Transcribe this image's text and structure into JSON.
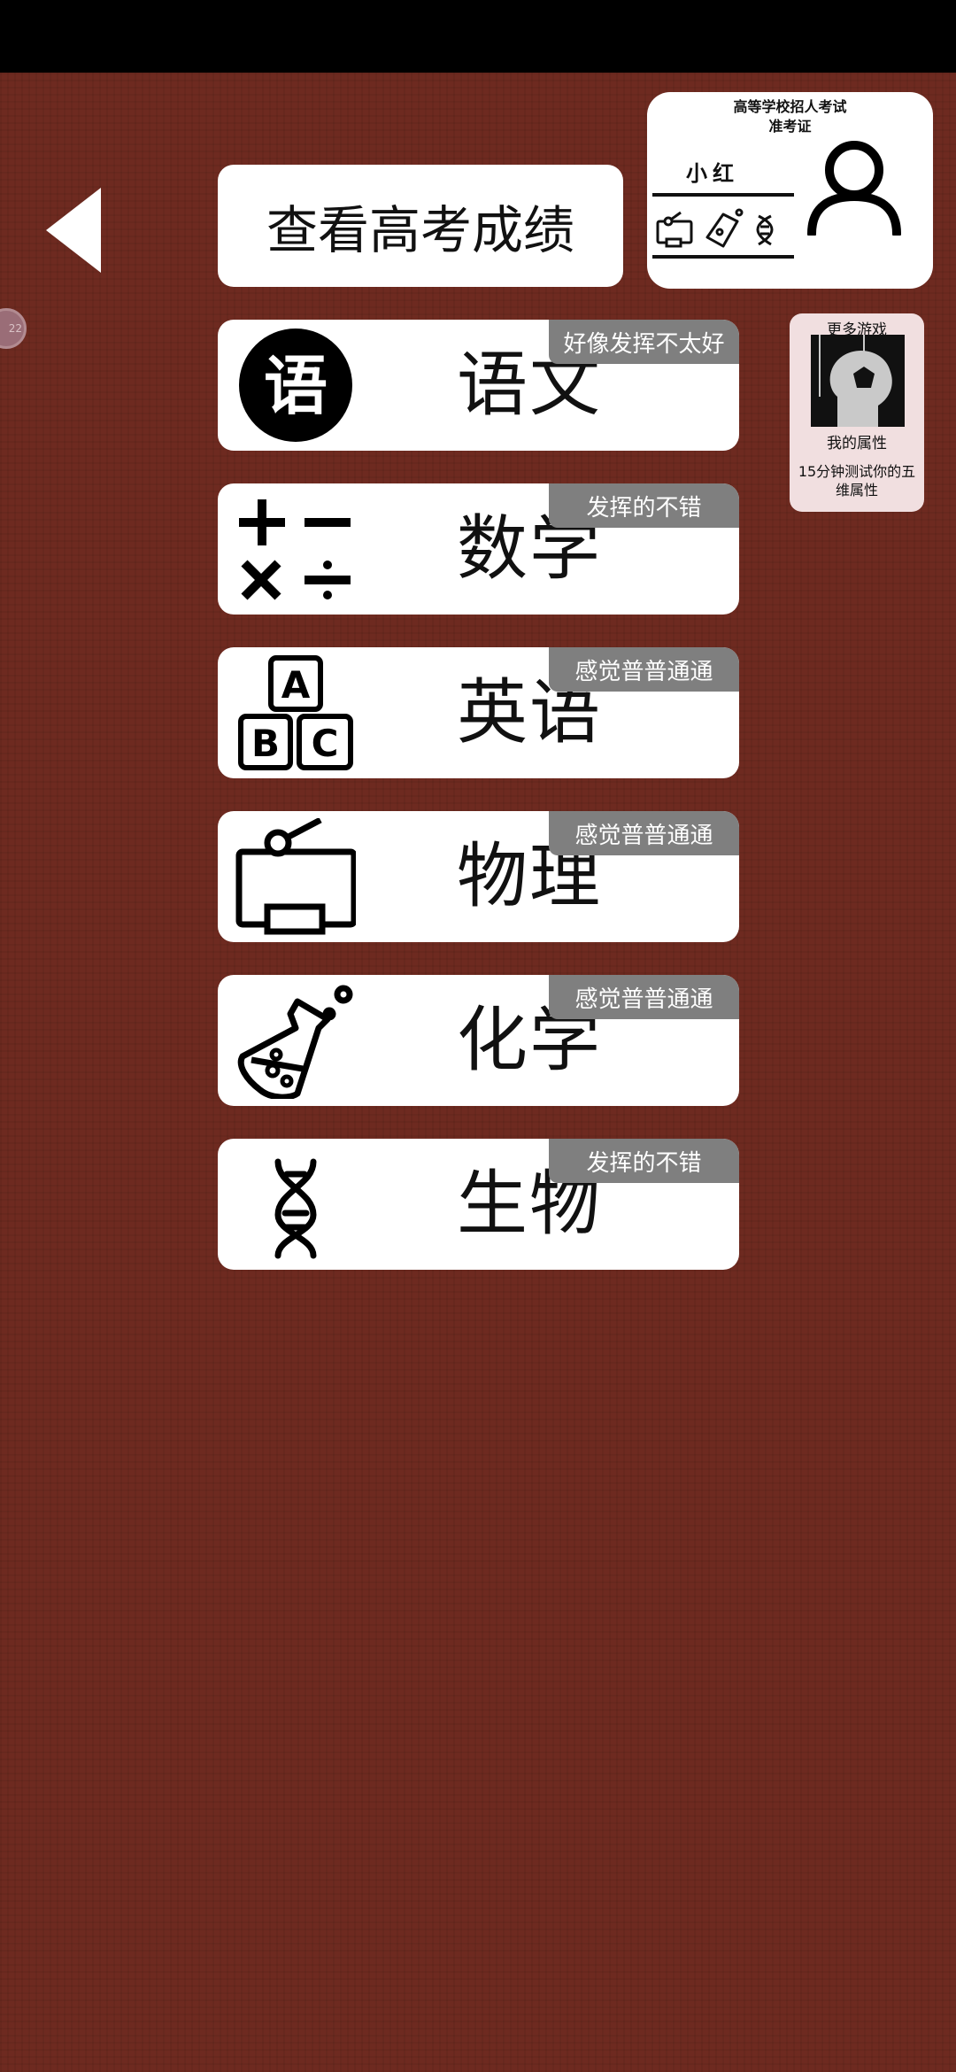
{
  "back_icon": "left-triangle-icon",
  "side_badge": "22",
  "view_scores_label": "查看高考成绩",
  "ticket": {
    "title": "高等学校招人考试",
    "subtitle": "准考证",
    "name": "小红",
    "avatar_icon": "person-icon"
  },
  "more_games": {
    "title": "更多游戏",
    "name": "我的属性",
    "desc": "15分钟测试你的五维属性"
  },
  "subjects": [
    {
      "name": "语文",
      "tag": "好像发挥不太好",
      "icon": "chinese-character-icon"
    },
    {
      "name": "数学",
      "tag": "发挥的不错",
      "icon": "math-operators-icon"
    },
    {
      "name": "英语",
      "tag": "感觉普普通通",
      "icon": "abc-blocks-icon"
    },
    {
      "name": "物理",
      "tag": "感觉普普通通",
      "icon": "circuit-icon"
    },
    {
      "name": "化学",
      "tag": "感觉普普通通",
      "icon": "flask-icon"
    },
    {
      "name": "生物",
      "tag": "发挥的不错",
      "icon": "dna-icon"
    }
  ],
  "colors": {
    "background": "#6e2a20",
    "tag": "#7f7f7f",
    "card": "#ffffff"
  }
}
